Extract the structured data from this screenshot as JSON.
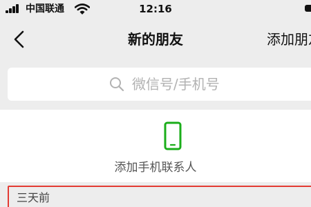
{
  "status_bar": {
    "carrier": "中国联通",
    "time": "12:16"
  },
  "nav": {
    "title": "新的朋友",
    "action_label": "添加朋友"
  },
  "search": {
    "placeholder": "微信号/手机号"
  },
  "contacts_entry": {
    "label": "添加手机联系人",
    "icon": "phone-icon",
    "icon_color": "#1aad19"
  },
  "section": {
    "label": "三天前",
    "highlight_color": "#e33b33"
  }
}
